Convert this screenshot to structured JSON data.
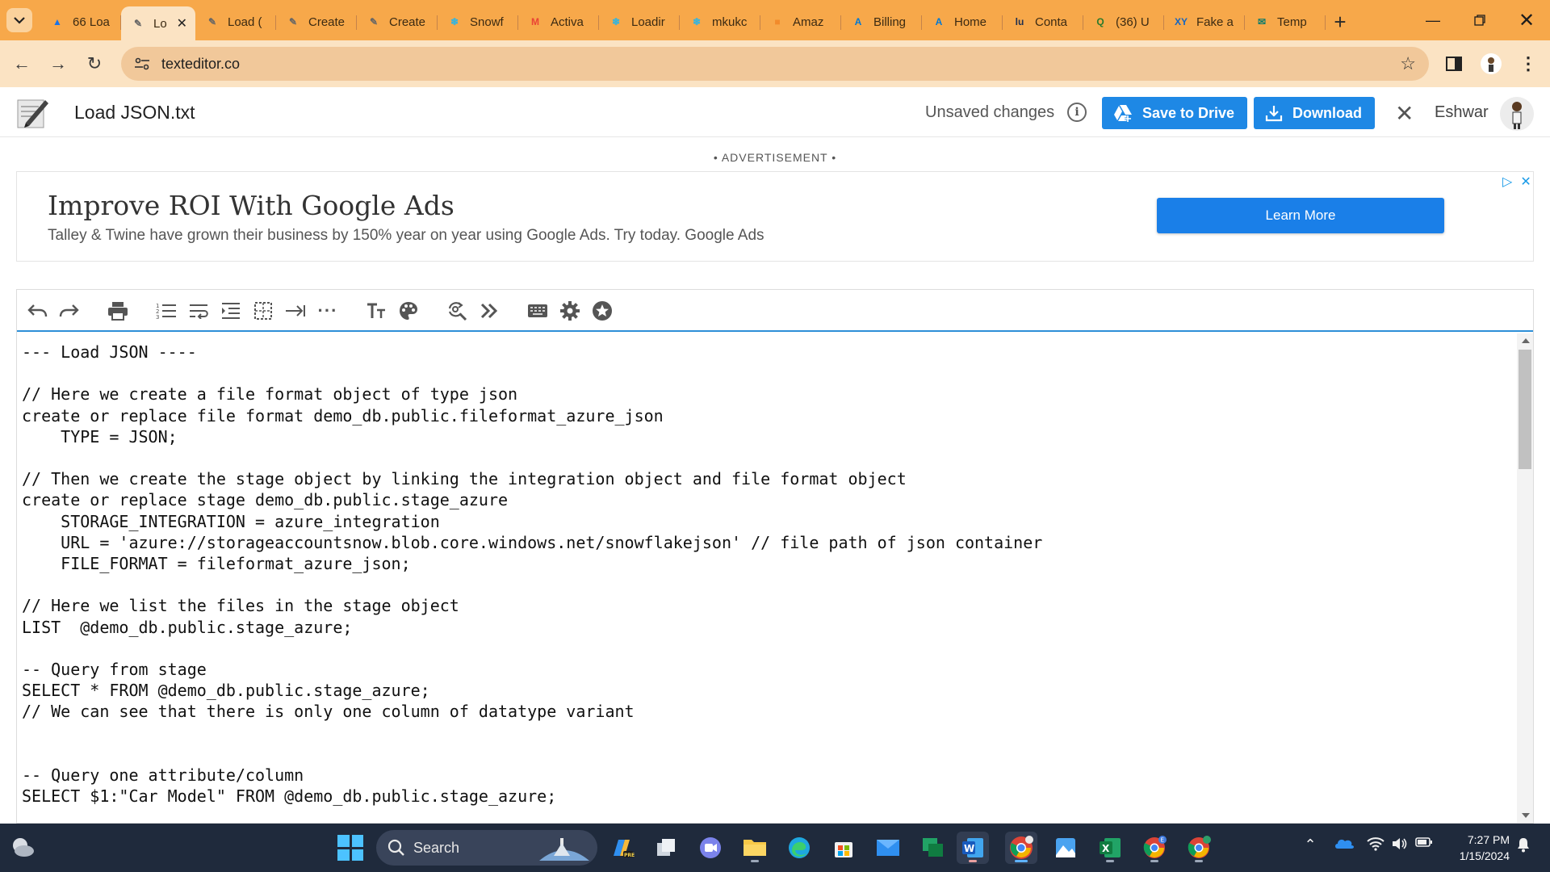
{
  "browser": {
    "tabs": [
      {
        "label": "66 Loa",
        "favicon": "drive-icon",
        "color": "#1a73e8",
        "active": false
      },
      {
        "label": "Lo",
        "favicon": "texteditor-icon",
        "color": "#666666",
        "active": true
      },
      {
        "label": "Load (",
        "favicon": "texteditor-icon",
        "color": "#666666",
        "active": false
      },
      {
        "label": "Create",
        "favicon": "texteditor-icon",
        "color": "#666666",
        "active": false
      },
      {
        "label": "Create",
        "favicon": "texteditor-icon",
        "color": "#666666",
        "active": false
      },
      {
        "label": "Snowf",
        "favicon": "snowflake-icon",
        "color": "#29b5e8",
        "active": false
      },
      {
        "label": "Activa",
        "favicon": "gmail-icon",
        "color": "#ea4335",
        "active": false
      },
      {
        "label": "Loadir",
        "favicon": "snowflake-icon",
        "color": "#29b5e8",
        "active": false
      },
      {
        "label": "mkukc",
        "favicon": "snowflake-icon",
        "color": "#29b5e8",
        "active": false
      },
      {
        "label": "Amaz",
        "favicon": "aws-icon",
        "color": "#f28b2b",
        "active": false
      },
      {
        "label": "Billing",
        "favicon": "azure-icon",
        "color": "#0078d4",
        "active": false
      },
      {
        "label": "Home",
        "favicon": "azure-icon",
        "color": "#0078d4",
        "active": false
      },
      {
        "label": "Conta",
        "favicon": "contact-icon",
        "color": "#1f2f4f",
        "active": false
      },
      {
        "label": "(36) U",
        "favicon": "quora-icon",
        "color": "#2b7a2b",
        "active": false
      },
      {
        "label": "Fake a",
        "favicon": "xy-icon",
        "color": "#1565c0",
        "active": false
      },
      {
        "label": "Temp",
        "favicon": "temp-icon",
        "color": "#0f7c6a",
        "active": false
      }
    ],
    "url": "texteditor.co"
  },
  "app": {
    "doc_title": "Load JSON.txt",
    "unsaved_label": "Unsaved changes",
    "save_drive_label": "Save to Drive",
    "download_label": "Download",
    "username": "Eshwar"
  },
  "ad": {
    "label": "• ADVERTISEMENT •",
    "headline": "Improve ROI With Google Ads",
    "body": "Talley & Twine have grown their business by 150% year on year using Google Ads. Try today. Google Ads",
    "cta": "Learn More"
  },
  "editor": {
    "lines": [
      "--- Load JSON ----",
      "",
      "// Here we create a file format object of type json",
      "create or replace file format demo_db.public.fileformat_azure_json",
      "    TYPE = JSON;",
      "",
      "// Then we create the stage object by linking the integration object and file format object",
      "create or replace stage demo_db.public.stage_azure",
      "    STORAGE_INTEGRATION = azure_integration",
      "    URL = 'azure://storageaccountsnow.blob.core.windows.net/snowflakejson' // file path of json container",
      "    FILE_FORMAT = fileformat_azure_json;",
      "",
      "// Here we list the files in the stage object",
      "LIST  @demo_db.public.stage_azure;",
      "",
      "-- Query from stage",
      "SELECT * FROM @demo_db.public.stage_azure;",
      "// We can see that there is only one column of datatype variant",
      "",
      "",
      "-- Query one attribute/column",
      "SELECT $1:\"Car Model\" FROM @demo_db.public.stage_azure;"
    ]
  },
  "taskbar": {
    "search_label": "Search",
    "time": "7:27 PM",
    "date": "1/15/2024"
  }
}
